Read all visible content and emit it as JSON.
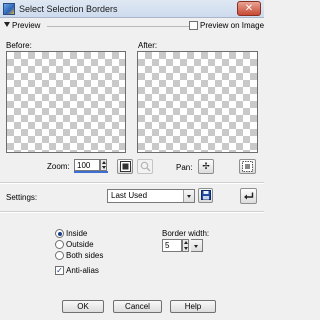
{
  "window": {
    "title": "Select Selection Borders",
    "close_glyph": "✕"
  },
  "preview": {
    "header": "Preview",
    "preview_on_image_label": "Preview on Image",
    "preview_on_image_checked": false,
    "before_label": "Before:",
    "after_label": "After:"
  },
  "zoom": {
    "label": "Zoom:",
    "value": "100"
  },
  "pan": {
    "label": "Pan:",
    "glyph": "✢"
  },
  "settings": {
    "label": "Settings:",
    "value": "Last Used"
  },
  "placement": {
    "options": [
      "Inside",
      "Outside",
      "Both sides"
    ],
    "selected": "Inside"
  },
  "border_width": {
    "label": "Border width:",
    "value": "5"
  },
  "anti_alias": {
    "label": "Anti-alias",
    "checked": true,
    "check_glyph": "✓"
  },
  "buttons": {
    "ok": "OK",
    "cancel": "Cancel",
    "help": "Help"
  },
  "icons": {
    "app": "app-icon",
    "close": "close-icon",
    "zoom_fit": "fit-window-icon",
    "zoom_actual": "magnifier-icon",
    "pan": "move-icon",
    "navigator": "navigator-icon",
    "save_preset": "floppy-disk-icon",
    "reset": "reset-arrow-icon"
  },
  "colors": {
    "accent": "#1a3f8a",
    "titlebar": "#d6e2f0",
    "close": "#c64a33"
  }
}
